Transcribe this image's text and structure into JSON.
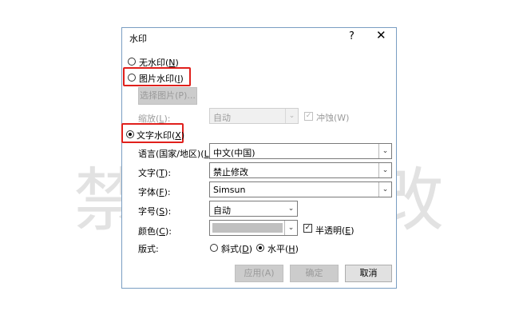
{
  "background_watermark": {
    "left_char": "禁",
    "right_char": "改"
  },
  "dialog": {
    "title": "水印",
    "help_label": "?",
    "close_label": "✕",
    "no_watermark": {
      "label": "无水印(",
      "key": "N",
      "end": ")",
      "selected": false
    },
    "picture_watermark": {
      "label": "图片水印(",
      "key": "I",
      "end": ")",
      "selected": false
    },
    "select_picture_button": "选择图片(P)...",
    "scale": {
      "label": "缩放(",
      "key": "L",
      "end": "):",
      "value": "自动"
    },
    "washout": {
      "label": "冲蚀(W)",
      "checked": true
    },
    "text_watermark": {
      "label": "文字水印(",
      "key": "X",
      "end": ")",
      "selected": true
    },
    "language": {
      "label": "语言(国家/地区)(",
      "key": "L",
      "end": "):",
      "value": "中文(中国)"
    },
    "text": {
      "label": "文字(",
      "key": "T",
      "end": "):",
      "value": "禁止修改"
    },
    "font": {
      "label": "字体(",
      "key": "F",
      "end": "):",
      "value": "Simsun"
    },
    "size": {
      "label": "字号(",
      "key": "S",
      "end": "):",
      "value": "自动"
    },
    "color": {
      "label": "颜色(",
      "key": "C",
      "end": "):",
      "swatch": "#c0c0c0"
    },
    "semitransparent": {
      "label": "半透明(",
      "key": "E",
      "end": ")",
      "checked": true
    },
    "layout": {
      "label": "版式:",
      "diagonal": {
        "label": "斜式(",
        "key": "D",
        "end": ")",
        "selected": false
      },
      "horizontal": {
        "label": "水平(",
        "key": "H",
        "end": ")",
        "selected": true
      }
    },
    "buttons": {
      "apply": "应用(A)",
      "ok": "确定",
      "cancel": "取消"
    }
  },
  "colors": {
    "highlight": "#e0201c",
    "dialog_border": "#7a9ec2",
    "watermark_text": "#e2e2e2"
  }
}
